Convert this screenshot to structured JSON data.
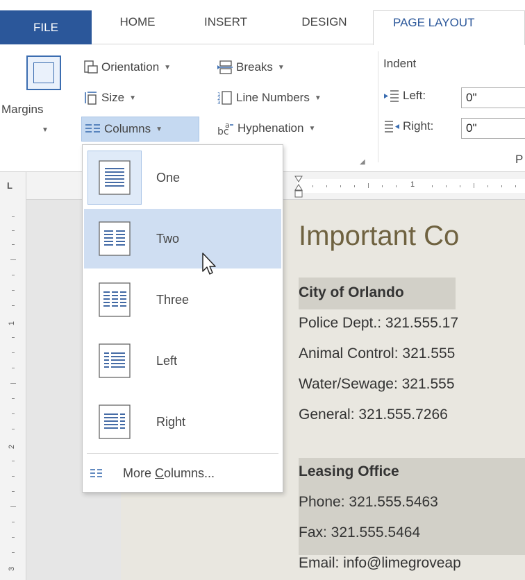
{
  "tabs": [
    {
      "label": "FILE"
    },
    {
      "label": "HOME"
    },
    {
      "label": "INSERT"
    },
    {
      "label": "DESIGN"
    },
    {
      "label": "PAGE LAYOUT"
    }
  ],
  "ribbon": {
    "margins": "Margins",
    "orientation": "Orientation",
    "size": "Size",
    "columns": "Columns",
    "breaks": "Breaks",
    "line_numbers": "Line Numbers",
    "hyphenation": "Hyphenation",
    "indent": {
      "title": "Indent",
      "left_label": "Left:",
      "left_value": "0\"",
      "right_label": "Right:",
      "right_value": "0\""
    },
    "group_fragment": "P"
  },
  "columns_menu": {
    "items": [
      {
        "label": "One",
        "icon": "one-column-icon"
      },
      {
        "label": "Two",
        "icon": "two-columns-icon"
      },
      {
        "label": "Three",
        "icon": "three-columns-icon"
      },
      {
        "label": "Left",
        "icon": "left-column-icon"
      },
      {
        "label": "Right",
        "icon": "right-column-icon"
      }
    ],
    "more_prefix": "More ",
    "more_underlined": "C",
    "more_suffix": "olumns...",
    "selected": "Two",
    "current": "One"
  },
  "ruler": {
    "h_number": "1",
    "v_numbers": [
      "1",
      "2",
      "3"
    ],
    "corner": "L"
  },
  "document": {
    "title": "Important Co",
    "lines": [
      {
        "text": "City of Orlando",
        "bold": true
      },
      {
        "text": "Police Dept.: 321.555.17"
      },
      {
        "text": "Animal Control: 321.555"
      },
      {
        "text": "Water/Sewage: 321.555"
      },
      {
        "text": "General: 321.555.7266"
      },
      {
        "text": "Leasing Office",
        "bold": true
      },
      {
        "text": "Phone: 321.555.5463"
      },
      {
        "text": "Fax: 321.555.5464"
      },
      {
        "text": "Email: info@limegroveap"
      }
    ]
  },
  "colors": {
    "file_tab": "#2b579a",
    "active_tab_text": "#2b579a",
    "selected_item": "#cfdef2",
    "title_text": "#6f6240",
    "text_shade": "#d2d0c8"
  }
}
